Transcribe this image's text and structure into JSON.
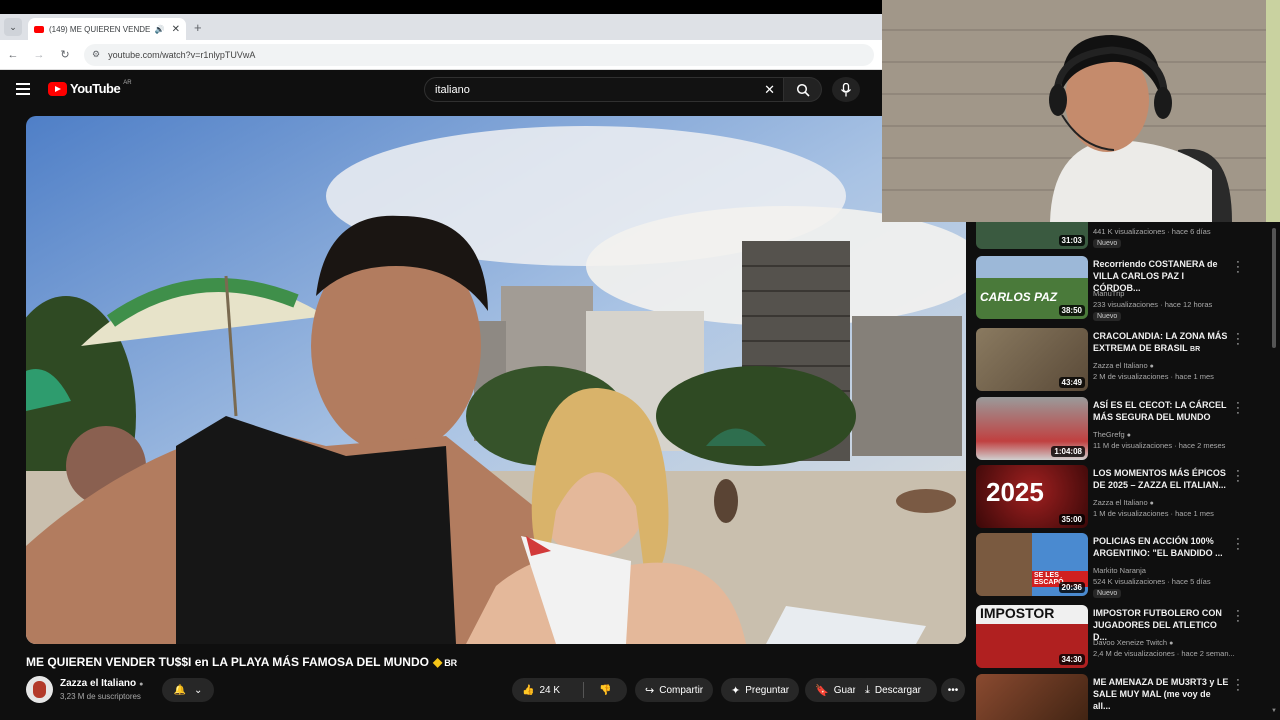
{
  "browser": {
    "tab_title": "(149) ME QUIEREN VENDER",
    "tab_new_symbol": "+",
    "url": "youtube.com/watch?v=r1nlypTUVwA"
  },
  "header": {
    "logo_text": "YouTube",
    "logo_country": "AR",
    "search_value": "italiano"
  },
  "video": {
    "title": "ME QUIEREN VENDER TU$$I en LA PLAYA MÁS FAMOSA DEL MUNDO",
    "title_suffix": "BR",
    "channel_name": "Zazza el Italiano",
    "subscribers": "3,23 M de suscriptores",
    "likes": "24 K",
    "actions": {
      "share": "Compartir",
      "clip": "Preguntar",
      "save": "Guardar",
      "download": "Descargar"
    }
  },
  "recommendations": [
    {
      "title": "",
      "channel": "",
      "meta": "441 K visualizaciones · hace 6 días",
      "duration": "31:03",
      "badge": "Nuevo",
      "thumb_color": "#3a5a40"
    },
    {
      "title": "Recorriendo COSTANERA de VILLA CARLOS PAZ I CÓRDOB...",
      "channel": "ManuTrip",
      "meta": "233 visualizaciones · hace 12 horas",
      "duration": "38:50",
      "badge": "Nuevo",
      "thumb_color": "#4a7a3a",
      "thumb_text": "CARLOS PAZ"
    },
    {
      "title": "CRACOLANDIA: LA ZONA MÁS EXTREMA DE BRASIL",
      "title_flag": "BR",
      "channel": "Zazza el Italiano",
      "meta": "2 M de visualizaciones · hace 1 mes",
      "duration": "43:49",
      "badge": "",
      "thumb_color": "#7a6a50"
    },
    {
      "title": "ASÍ ES EL CECOT: LA CÁRCEL MÁS SEGURA DEL MUNDO",
      "channel": "TheGrefg",
      "meta": "11 M de visualizaciones · hace 2 meses",
      "duration": "1:04:08",
      "badge": "",
      "thumb_color": "#8a8a8a"
    },
    {
      "title": "LOS MOMENTOS MÁS ÉPICOS DE 2025 – ZAZZA EL ITALIAN...",
      "channel": "Zazza el Italiano",
      "meta": "1 M de visualizaciones · hace 1 mes",
      "duration": "35:00",
      "badge": "",
      "thumb_color": "#5a1010",
      "thumb_text": "2025"
    },
    {
      "title": "POLICIAS EN ACCIÓN 100% ARGENTINO: \"EL BANDIDO ...",
      "channel": "Markito Naranja",
      "meta": "524 K visualizaciones · hace 5 días",
      "duration": "20:36",
      "badge": "Nuevo",
      "thumb_color": "#3a5f9a",
      "thumb_text": "SE LES ESCAPÓ"
    },
    {
      "title": "IMPOSTOR FUTBOLERO CON JUGADORES DEL ATLETICO D...",
      "channel": "Davoo Xeneize Twitch",
      "meta": "2,4 M de visualizaciones · hace 2 seman...",
      "duration": "34:30",
      "badge": "",
      "thumb_color": "#e8e8e8",
      "thumb_text": "IMPOSTOR"
    },
    {
      "title": "ME AMENAZA DE MU3RT3 y LE SALE MUY MAL (me voy de all...",
      "channel": "",
      "meta": "",
      "duration": "",
      "badge": "",
      "thumb_color": "#6a3020"
    }
  ],
  "colors": {
    "brand": "#ff0000",
    "background": "#0f0f0f",
    "pill": "#272727"
  }
}
